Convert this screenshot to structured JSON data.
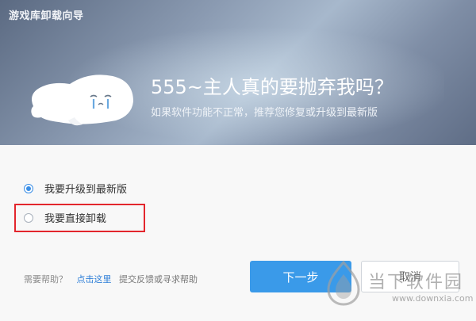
{
  "window": {
    "title": "游戏库卸载向导"
  },
  "banner": {
    "headline": "555~主人真的要抛弃我吗？",
    "subline": "如果软件功能不正常，推荐您修复或升级到最新版"
  },
  "options": [
    {
      "label": "我要升级到最新版",
      "checked": true
    },
    {
      "label": "我要直接卸载",
      "checked": false
    }
  ],
  "help": {
    "question": "需要帮助？",
    "link": "点击这里",
    "text": "提交反馈或寻求帮助"
  },
  "buttons": {
    "next": "下一步",
    "cancel": "取消"
  },
  "watermark": {
    "name": "当下软件园",
    "url": "www.downxia.com"
  },
  "colors": {
    "accent": "#3a9ae9",
    "highlight_border": "#e3262d"
  }
}
